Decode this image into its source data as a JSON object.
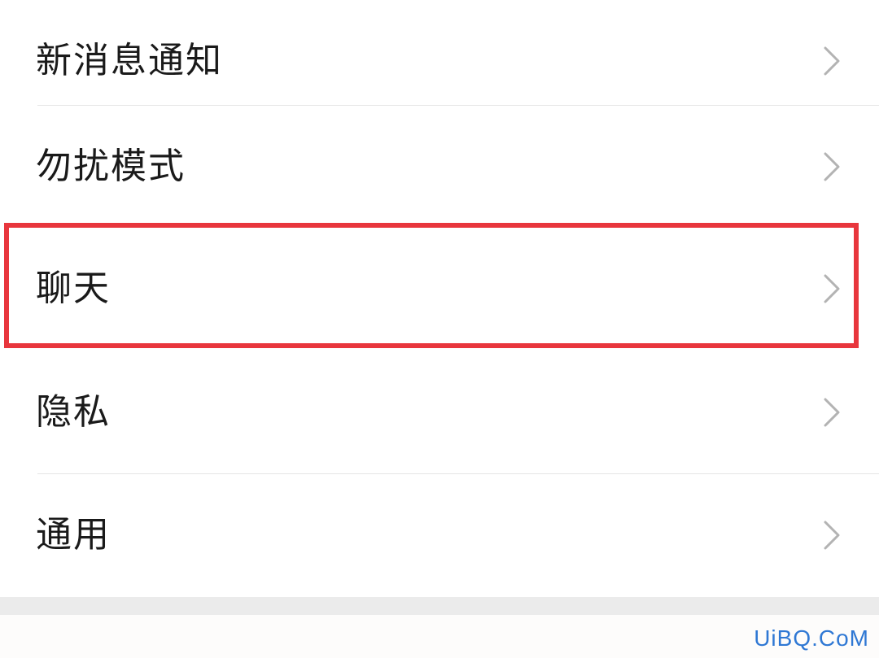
{
  "settings": {
    "items": [
      {
        "label": "新消息通知",
        "icon": "chevron-right-icon"
      },
      {
        "label": "勿扰模式",
        "icon": "chevron-right-icon"
      },
      {
        "label": "聊天",
        "icon": "chevron-right-icon",
        "highlighted": true
      },
      {
        "label": "隐私",
        "icon": "chevron-right-icon"
      },
      {
        "label": "通用",
        "icon": "chevron-right-icon"
      }
    ]
  },
  "annotation": {
    "highlight_color": "#e8363d"
  },
  "watermark": {
    "text": "UiBQ.CoM",
    "color": "#2f78d4"
  }
}
